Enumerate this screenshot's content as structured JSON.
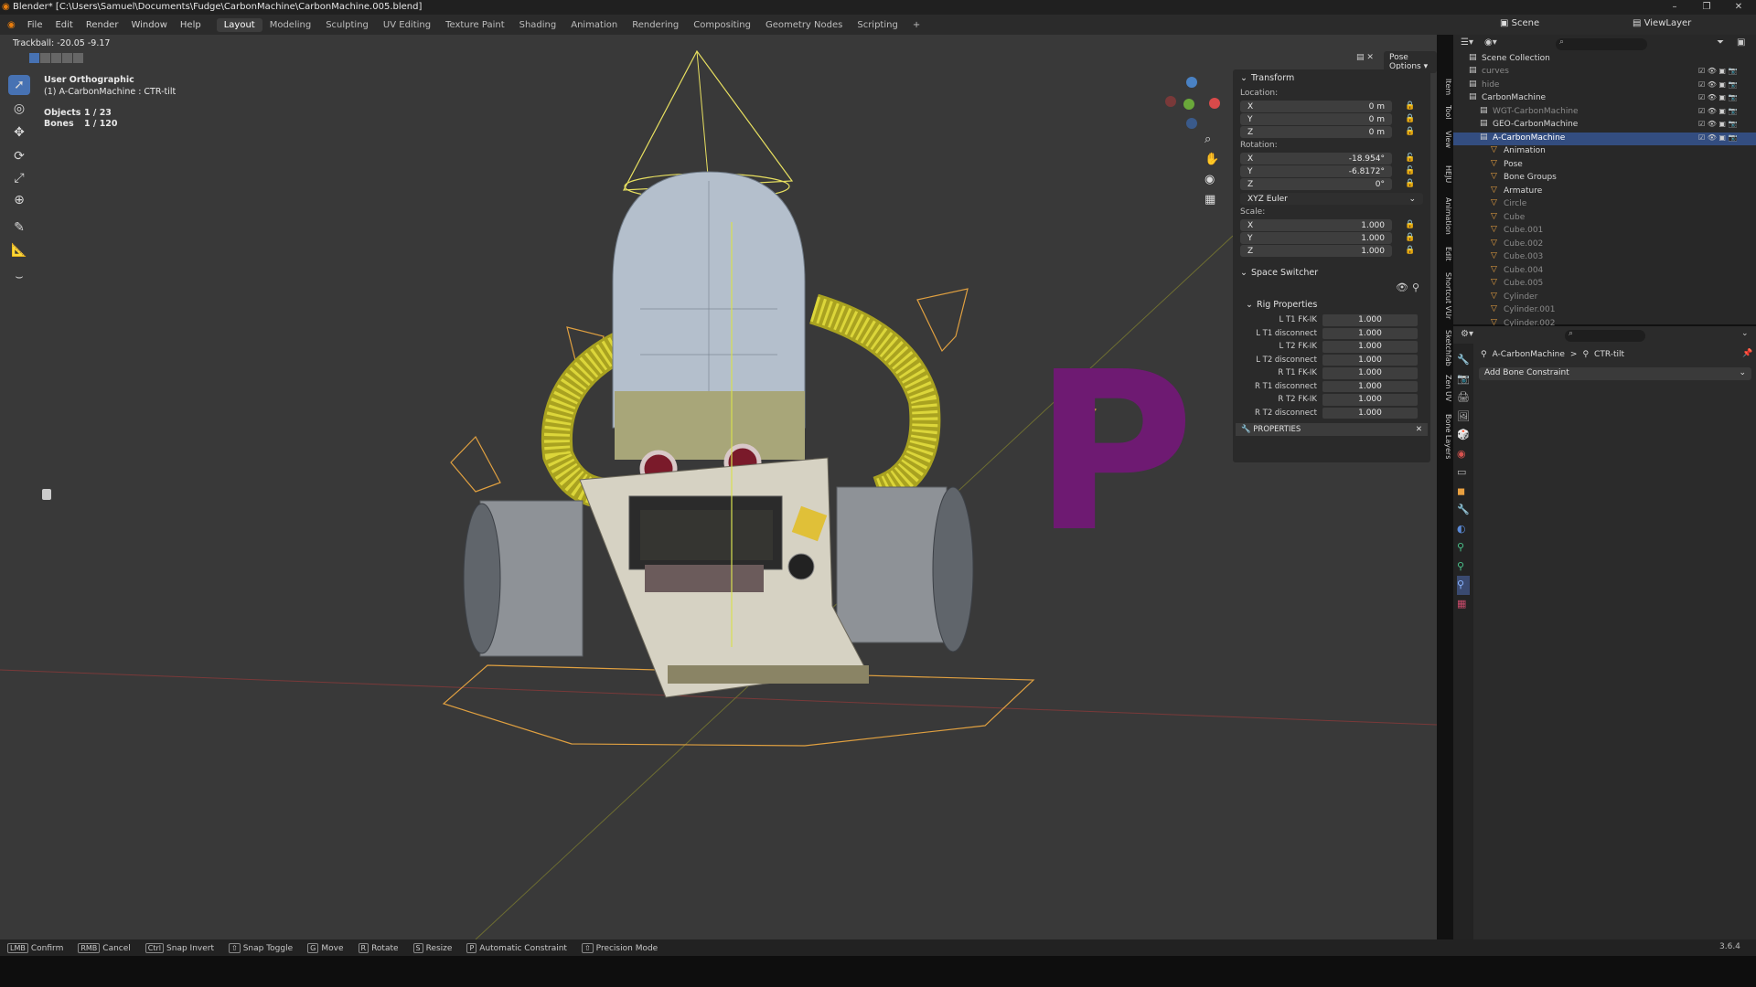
{
  "window": {
    "title": "Blender* [C:\\Users\\Samuel\\Documents\\Fudge\\CarbonMachine\\CarbonMachine.005.blend]",
    "controls": [
      "–",
      "❐",
      "✕"
    ]
  },
  "menu": [
    "File",
    "Edit",
    "Render",
    "Window",
    "Help"
  ],
  "workspaces": [
    "Layout",
    "Modeling",
    "Sculpting",
    "UV Editing",
    "Texture Paint",
    "Shading",
    "Animation",
    "Rendering",
    "Compositing",
    "Geometry Nodes",
    "Scripting"
  ],
  "active_workspace": "Layout",
  "add_workspace": "+",
  "scene": {
    "label": "Scene",
    "view_layer": "ViewLayer"
  },
  "viewport": {
    "trackball": "Trackball: -20.05 -9.17",
    "view_name": "User Orthographic",
    "active_object": "(1) A-CarbonMachine : CTR-tilt",
    "objects_label": "Objects",
    "objects_value": "1 / 23",
    "bones_label": "Bones",
    "bones_value": "1 / 120",
    "pose_options": "Pose Options",
    "big_letter": "P",
    "accent_purple": "#6e1a72"
  },
  "npanel": {
    "transform": {
      "title": "Transform",
      "location_label": "Location:",
      "location": [
        {
          "axis": "X",
          "value": "0 m"
        },
        {
          "axis": "Y",
          "value": "0 m"
        },
        {
          "axis": "Z",
          "value": "0 m"
        }
      ],
      "rotation_label": "Rotation:",
      "rotation": [
        {
          "axis": "X",
          "value": "-18.954°"
        },
        {
          "axis": "Y",
          "value": "-6.8172°"
        },
        {
          "axis": "Z",
          "value": "0°"
        }
      ],
      "rotation_mode": "XYZ Euler",
      "scale_label": "Scale:",
      "scale": [
        {
          "axis": "X",
          "value": "1.000"
        },
        {
          "axis": "Y",
          "value": "1.000"
        },
        {
          "axis": "Z",
          "value": "1.000"
        }
      ]
    },
    "space_switcher": {
      "title": "Space Switcher"
    },
    "rig_properties": {
      "title": "Rig Properties",
      "rows": [
        {
          "label": "L T1 FK-IK",
          "value": "1.000"
        },
        {
          "label": "L T1 disconnect",
          "value": "1.000"
        },
        {
          "label": "L T2 FK-IK",
          "value": "1.000"
        },
        {
          "label": "L T2 disconnect",
          "value": "1.000"
        },
        {
          "label": "R T1 FK-IK",
          "value": "1.000"
        },
        {
          "label": "R T1 disconnect",
          "value": "1.000"
        },
        {
          "label": "R T2 FK-IK",
          "value": "1.000"
        },
        {
          "label": "R T2 disconnect",
          "value": "1.000"
        }
      ]
    },
    "properties_bar": "PROPERTIES"
  },
  "side_tabs": [
    "Item",
    "Tool",
    "View",
    "HEJU",
    "Animation",
    "Edit",
    "Shortcut VUr",
    "Sketchfab",
    "Zen UV",
    "Bone Layers"
  ],
  "outliner": {
    "root": "Scene Collection",
    "rows": [
      {
        "name": "curves",
        "indent": 1,
        "dim": true
      },
      {
        "name": "hide",
        "indent": 1,
        "dim": true
      },
      {
        "name": "CarbonMachine",
        "indent": 1,
        "dim": false
      },
      {
        "name": "WGT-CarbonMachine",
        "indent": 2,
        "dim": true
      },
      {
        "name": "GEO-CarbonMachine",
        "indent": 2,
        "dim": false
      },
      {
        "name": "A-CarbonMachine",
        "indent": 2,
        "dim": false,
        "selected": true
      },
      {
        "name": "Animation",
        "indent": 3,
        "dim": false
      },
      {
        "name": "Pose",
        "indent": 3,
        "dim": false
      },
      {
        "name": "Bone Groups",
        "indent": 3,
        "dim": false
      },
      {
        "name": "Armature",
        "indent": 3,
        "dim": false
      },
      {
        "name": "Circle",
        "indent": 3,
        "dim": true
      },
      {
        "name": "Cube",
        "indent": 3,
        "dim": true
      },
      {
        "name": "Cube.001",
        "indent": 3,
        "dim": true
      },
      {
        "name": "Cube.002",
        "indent": 3,
        "dim": true
      },
      {
        "name": "Cube.003",
        "indent": 3,
        "dim": true
      },
      {
        "name": "Cube.004",
        "indent": 3,
        "dim": true
      },
      {
        "name": "Cube.005",
        "indent": 3,
        "dim": true
      },
      {
        "name": "Cylinder",
        "indent": 3,
        "dim": true
      },
      {
        "name": "Cylinder.001",
        "indent": 3,
        "dim": true
      },
      {
        "name": "Cylinder.002",
        "indent": 3,
        "dim": true
      }
    ]
  },
  "properties": {
    "breadcrumb_object": "A-CarbonMachine",
    "breadcrumb_sep": ">",
    "breadcrumb_bone": "CTR-tilt",
    "add_constraint": "Add Bone Constraint"
  },
  "statusbar": {
    "items": [
      {
        "key": "LMB",
        "label": "Confirm"
      },
      {
        "key": "RMB",
        "label": "Cancel"
      },
      {
        "key": "Ctrl",
        "label": "Snap Invert"
      },
      {
        "key": "⇧",
        "label": "Snap Toggle"
      },
      {
        "key": "G",
        "label": "Move"
      },
      {
        "key": "R",
        "label": "Rotate"
      },
      {
        "key": "S",
        "label": "Resize"
      },
      {
        "key": "P",
        "label": "Automatic Constraint"
      },
      {
        "key": "⇧",
        "label": "Precision Mode"
      }
    ],
    "version": "3.6.4"
  }
}
